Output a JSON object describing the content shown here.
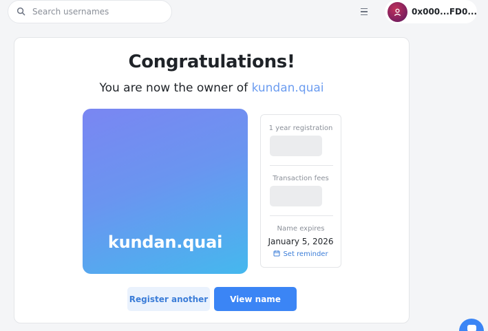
{
  "search": {
    "placeholder": "Search usernames"
  },
  "header": {
    "account_address": "0x000...FD0..."
  },
  "main": {
    "title": "Congratulations!",
    "subtitle_prefix": "You are now the owner of ",
    "owned_name": "kundan.quai",
    "tile_label": "kundan.quai",
    "details": {
      "registration_label": "1 year registration",
      "fees_label": "Transaction fees",
      "expires_label": "Name expires",
      "expires_value": "January 5, 2026",
      "reminder_label": "Set reminder"
    },
    "buttons": {
      "register_another": "Register another",
      "view_name": "View name"
    }
  },
  "colors": {
    "accent": "#3b85f5",
    "name_highlight": "#6b9cf0",
    "tile_gradient_start": "#7a86f2",
    "tile_gradient_end": "#45b8ee"
  },
  "icons": {
    "search": "search-icon",
    "menu": "hamburger-menu-icon",
    "avatar": "user-avatar-icon",
    "calendar": "calendar-icon",
    "chat": "chat-icon"
  }
}
